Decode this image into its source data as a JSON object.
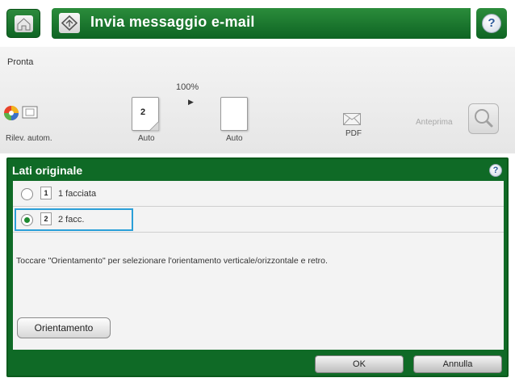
{
  "header": {
    "title": "Invia messaggio e-mail",
    "help_glyph": "?",
    "icons": [
      "home-icon",
      "app-send-icon",
      "help-icon"
    ]
  },
  "status": {
    "text": "Pronta"
  },
  "options": {
    "zoom": "100%",
    "scan_label": "Rilev. autom.",
    "sides_page_number": "2",
    "sides_label": "Auto",
    "color_label": "Auto",
    "file_type_label": "PDF",
    "preview_label": "Anteprima"
  },
  "dialog": {
    "title": "Lati originale",
    "help_glyph": "?",
    "options": [
      {
        "icon_number": "1",
        "label": "1 facciata",
        "selected": false
      },
      {
        "icon_number": "2",
        "label": "2 facc.",
        "selected": true
      }
    ],
    "hint": "Toccare \"Orientamento\" per selezionare l'orientamento verticale/orizzontale e retro.",
    "orientation_button": "Orientamento",
    "ok_button": "OK",
    "cancel_button": "Annulla"
  },
  "colors": {
    "brand_green": "#0f6a26",
    "selection_blue": "#2b9fd8"
  }
}
